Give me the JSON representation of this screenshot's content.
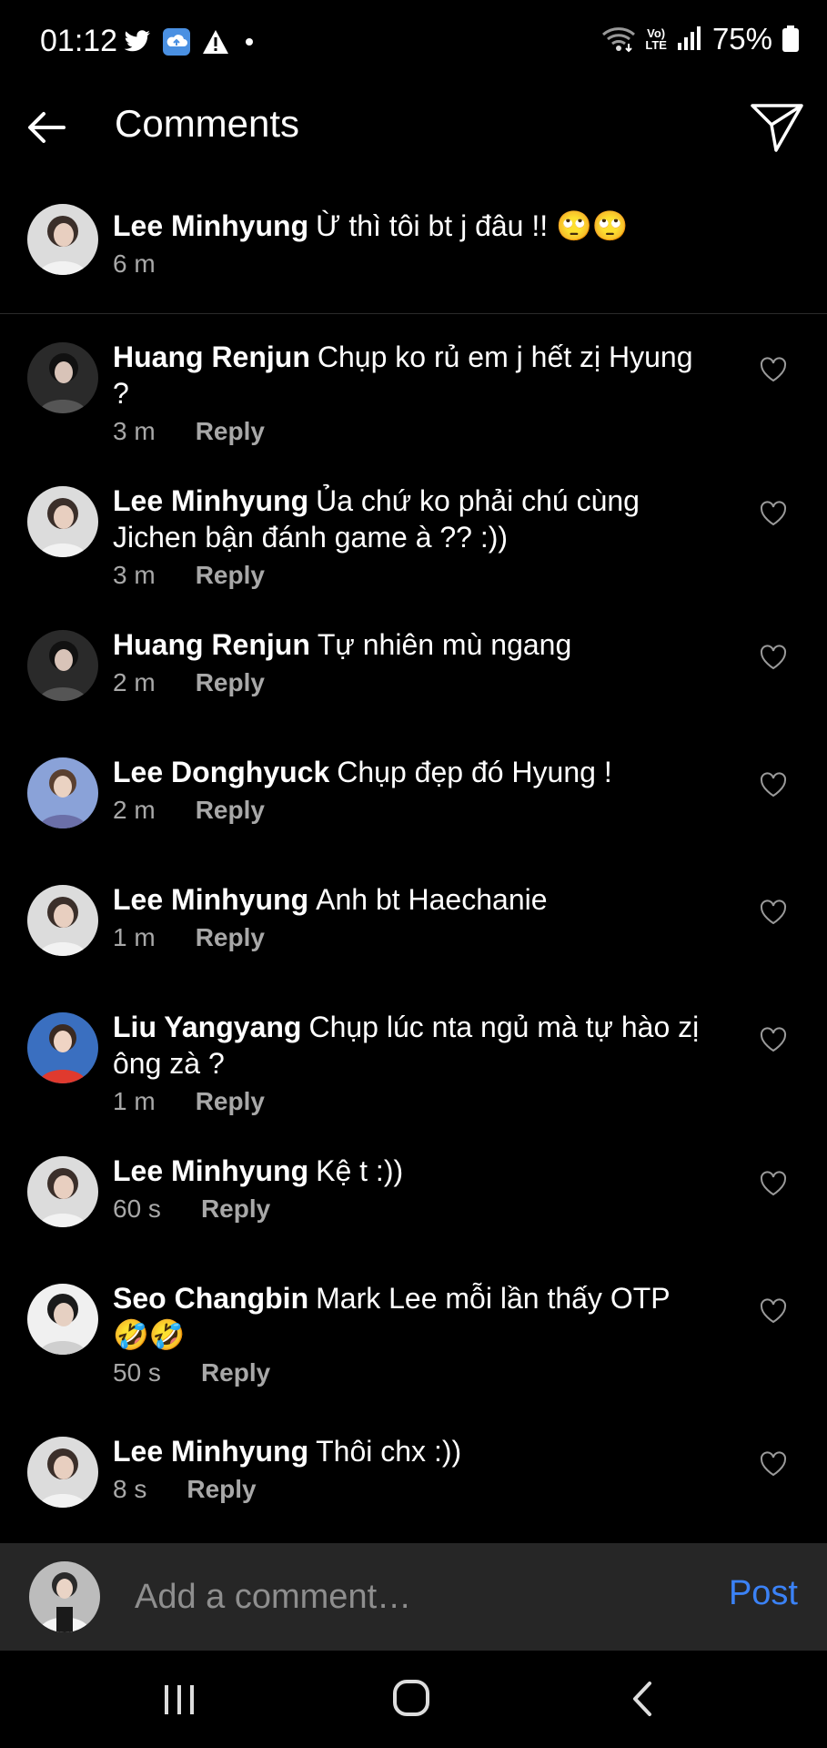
{
  "status_bar": {
    "time": "01:12",
    "lte_top": "Vo)",
    "lte_bottom": "LTE",
    "battery": "75%",
    "icons": [
      "twitter-icon",
      "cloud-upload-icon",
      "warning-icon",
      "dot-icon",
      "wifi-icon",
      "signal-icon",
      "battery-icon"
    ]
  },
  "header": {
    "title": "Comments"
  },
  "caption": {
    "username": "Lee Minhyung",
    "text": "Ừ thì tôi bt j đâu !! 🙄🙄",
    "time": "6 m"
  },
  "comments": [
    {
      "username": "Huang Renjun",
      "text": "Chụp ko rủ em j hết zị Hyung ?",
      "time": "3 m",
      "reply": "Reply"
    },
    {
      "username": "Lee Minhyung",
      "text": "Ủa chứ ko phải chú cùng Jichen bận đánh game à ?? :))",
      "time": "3 m",
      "reply": "Reply"
    },
    {
      "username": "Huang Renjun",
      "text": "Tự nhiên mù ngang",
      "time": "2 m",
      "reply": "Reply"
    },
    {
      "username": "Lee Donghyuck",
      "text": "Chụp đẹp đó Hyung !",
      "time": "2 m",
      "reply": "Reply"
    },
    {
      "username": "Lee Minhyung",
      "text": "Anh bt Haechanie",
      "time": "1 m",
      "reply": "Reply"
    },
    {
      "username": "Liu Yangyang",
      "text": "Chụp lúc nta ngủ mà tự hào zị ông zà ?",
      "time": "1 m",
      "reply": "Reply"
    },
    {
      "username": "Lee Minhyung",
      "text": "Kệ t :))",
      "time": "60 s",
      "reply": "Reply"
    },
    {
      "username": "Seo Changbin",
      "text": "Mark Lee mỗi lần thấy OTP 🤣🤣",
      "time": "50 s",
      "reply": "Reply"
    },
    {
      "username": "Lee Minhyung",
      "text": "Thôi chx :))",
      "time": "8 s",
      "reply": "Reply"
    }
  ],
  "input": {
    "placeholder": "Add a comment…",
    "post_label": "Post"
  },
  "colors": {
    "background": "#000000",
    "input_bar": "#262626",
    "post": "#3b82f6",
    "meta": "#a8a8a8"
  }
}
